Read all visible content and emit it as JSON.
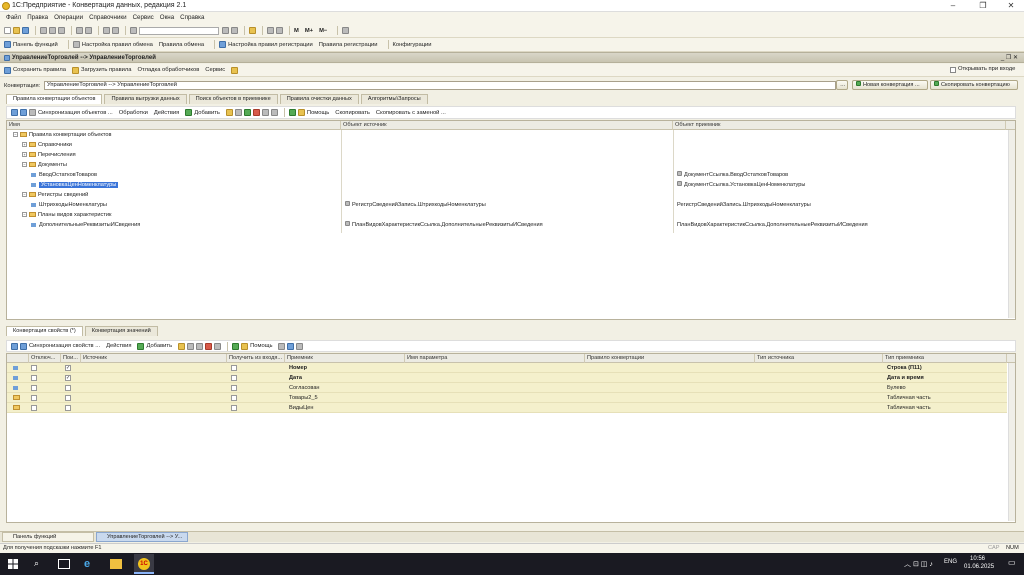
{
  "window": {
    "title": "1С:Предприятие - Конвертация данных, редакция 2.1"
  },
  "menu": [
    "Файл",
    "Правка",
    "Операции",
    "Справочники",
    "Сервис",
    "Окна",
    "Справка"
  ],
  "toolbar2": {
    "functions_panel": "Панель функций",
    "exchange_rules_setup": "Настройка правил обмена",
    "exchange_rules": "Правила обмена",
    "registration_rules_setup": "Настройка правил регистрации",
    "registration_rules": "Правила регистрации",
    "configurations": "Конфигурации"
  },
  "subwindow": {
    "title": "УправлениеТорговлей --> УправлениеТорговлей"
  },
  "form_toolbar": {
    "save_rules": "Сохранить правила",
    "load_rules": "Загрузить правила",
    "debug_handlers": "Отладка обработчиков",
    "service": "Сервис",
    "open_on_login": "Открывать при входе"
  },
  "conversion": {
    "label": "Конвертация:",
    "value": "УправлениеТорговлей --> УправлениеТорговлей",
    "new_button": "Новая конвертация ...",
    "copy_button": "Скопировать конвертацию"
  },
  "top_tabs": [
    "Правила конвертации объектов",
    "Правила выгрузки данных",
    "Поиск объектов в приемнике",
    "Правила очистки данных",
    "Алгоритмы\\Запросы"
  ],
  "top_toolbar": {
    "sync": "Синхронизация объектов ...",
    "handlers": "Обработки",
    "actions": "Действия",
    "add": "Добавить",
    "help": "Помощь",
    "copy": "Скопировать",
    "copy_with_replace": "Скопировать с заменой ..."
  },
  "top_grid": {
    "columns": [
      "Имя",
      "Объект источник",
      "Объект приемник"
    ],
    "rows": [
      {
        "level": 0,
        "kind": "folder",
        "exp": "−",
        "name": "Правила конвертации объектов",
        "src": "",
        "dst": ""
      },
      {
        "level": 1,
        "kind": "folder",
        "exp": "+",
        "name": "Справочники",
        "src": "",
        "dst": ""
      },
      {
        "level": 1,
        "kind": "folder",
        "exp": "+",
        "name": "Перечисления",
        "src": "",
        "dst": ""
      },
      {
        "level": 1,
        "kind": "folder",
        "exp": "−",
        "name": "Документы",
        "src": "",
        "dst": ""
      },
      {
        "level": 2,
        "kind": "doc",
        "exp": "",
        "name": "ВводОстатковТоваров",
        "src": "",
        "dst": "ДокументСсылка.ВводОстатковТоваров"
      },
      {
        "level": 2,
        "kind": "doc",
        "exp": "",
        "name": "УстановкаЦенНоменклатуры",
        "src": "",
        "dst": "ДокументСсылка.УстановкаЦенНоменклатуры",
        "selected": true
      },
      {
        "level": 1,
        "kind": "folder",
        "exp": "−",
        "name": "Регистры сведений",
        "src": "",
        "dst": ""
      },
      {
        "level": 2,
        "kind": "doc",
        "exp": "",
        "name": "ШтрихкодыНоменклатуры",
        "src": "РегистрСведенийЗапись.ШтрихкодыНоменклатуры",
        "dst": "РегистрСведенийЗапись.ШтрихкодыНоменклатуры"
      },
      {
        "level": 1,
        "kind": "folder",
        "exp": "−",
        "name": "Планы видов характеристик",
        "src": "",
        "dst": ""
      },
      {
        "level": 2,
        "kind": "doc",
        "exp": "",
        "name": "ДополнительныеРеквизитыИСведения",
        "src": "ПланВидовХарактеристикСсылка.ДополнительныеРеквизитыИСведения",
        "dst": "ПланВидовХарактеристикСсылка.ДополнительныеРеквизитыИСведения"
      }
    ]
  },
  "bottom_tabs": [
    "Конвертация свойств (*)",
    "Конвертация значений"
  ],
  "bottom_toolbar": {
    "sync": "Синхронизация свойств ...",
    "actions": "Действия",
    "add": "Добавить",
    "help": "Помощь"
  },
  "bottom_grid": {
    "columns": [
      "Отключ...",
      "Пои...",
      "Источник",
      "Получить из входя...",
      "Приемник",
      "Имя параметра",
      "Правило конвертации",
      "Тип источника",
      "Тип приемника"
    ],
    "rows": [
      {
        "search": "✓",
        "dest": "Номер",
        "dest_type": "Строка (П11)",
        "bold": true
      },
      {
        "search": "✓",
        "dest": "Дата",
        "dest_type": "Дата и время",
        "bold": true
      },
      {
        "search": "",
        "dest": "Согласован",
        "dest_type": "Булево",
        "bold": false
      },
      {
        "search": "",
        "dest": "Товары2_5",
        "dest_type": "Табличная часть",
        "bold": false
      },
      {
        "search": "",
        "dest": "ВидыЦен",
        "dest_type": "Табличная часть",
        "bold": false
      }
    ]
  },
  "windows_panel": {
    "item1": "Панель функций",
    "item2": "УправлениеТорговлей --> У..."
  },
  "status": {
    "hint": "Для получения подсказки нажмите F1",
    "cap": "CAP",
    "num": "NUM"
  },
  "taskbar": {
    "lang": "ENG",
    "time": "10:56",
    "date": "01.06.2025"
  }
}
